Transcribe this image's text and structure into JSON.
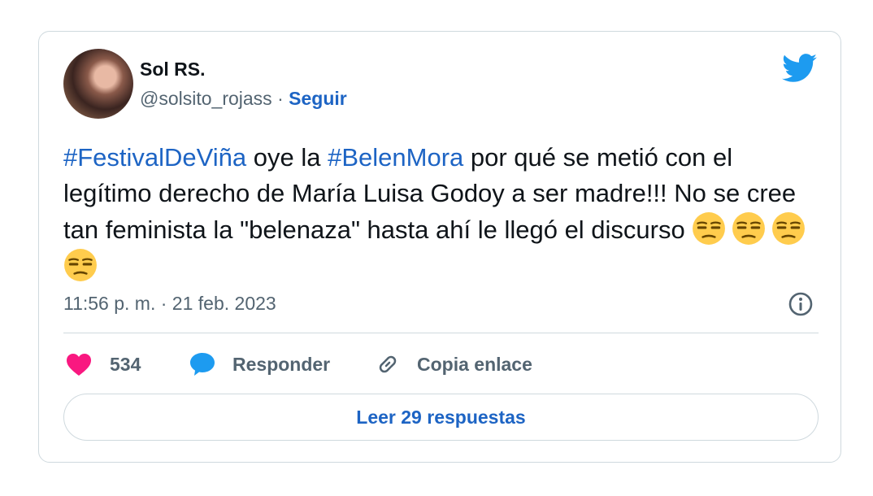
{
  "author": {
    "display_name": "Sol RS.",
    "handle": "@solsito_rojass",
    "separator": "·",
    "follow_label": "Seguir"
  },
  "tweet": {
    "hashtag_1": "#FestivalDeViña",
    "text_1": " oye la ",
    "hashtag_2": "#BelenMora",
    "text_2": " por qué se metió con el legítimo derecho de María Luisa Godoy a ser madre!!! No se cree tan feminista la \"belenaza\" hasta ahí le llegó el discurso ",
    "emoji": [
      "unamused-face",
      "unamused-face",
      "unamused-face",
      "unamused-face"
    ],
    "timestamp": "11:56 p. m. · 21 feb. 2023"
  },
  "actions": {
    "like_count": "534",
    "reply_label": "Responder",
    "copy_link_label": "Copia enlace"
  },
  "read_replies_label": "Leer 29 respuestas",
  "colors": {
    "link": "#1d64c4",
    "twitter_blue": "#1d9bf0",
    "heart": "#f91880",
    "muted": "#536471",
    "border": "#cfd9de"
  }
}
